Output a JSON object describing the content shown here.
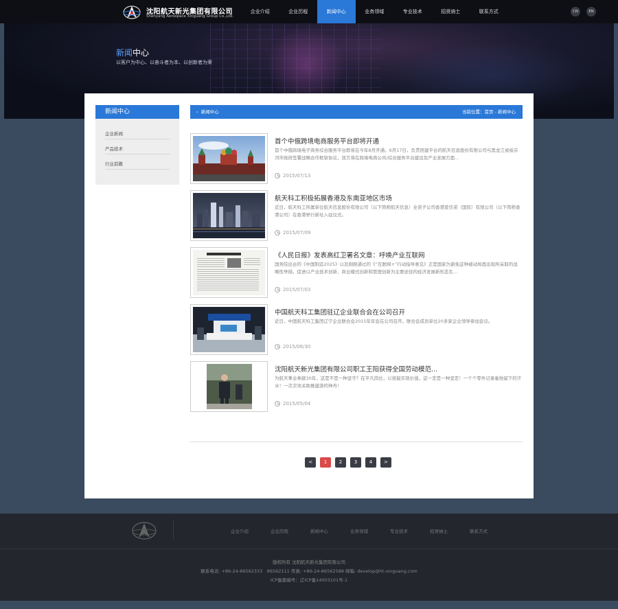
{
  "header": {
    "logo_cn": "沈阳航天新光集团有限公司",
    "logo_en": "Shenyang Aerospace Xinguang Group Co.,Ltd.",
    "nav": [
      "企业介绍",
      "企业历程",
      "新闻中心",
      "业务领域",
      "专业技术",
      "招贤纳士",
      "联系方式"
    ],
    "active_nav": 2,
    "lang": [
      "CN",
      "EN"
    ]
  },
  "hero": {
    "title_hl": "新闻",
    "title_rest": "中心",
    "subtitle": "以客户为中心、以奋斗者为本、以创新者为荣"
  },
  "sidebar": {
    "title": "新闻中心",
    "items": [
      "企业新闻",
      "产品技术",
      "行业前瞻"
    ]
  },
  "breadcrumb": {
    "section": "新闻中心",
    "location_label": "当前位置：",
    "home": "首页",
    "sep": " - ",
    "current": "新闻中心"
  },
  "news": [
    {
      "title": "首个中俄跨境电商服务平台即将开通",
      "desc": "首个中俄跨境电子商务综合服务平台即将在今年8月开通。6月17日，负责搭建平台的航天信息股份有限公司与黑龙江省绥芬河市政府签署战略合作框架协议，双方将在跨境电商公共/综合服务平台建设及产业发展方面...",
      "date": "2015/07/13",
      "image": "moscow-kremlin-photo"
    },
    {
      "title": "航天科工积极拓展香港及东南亚地区市场",
      "desc": "近日，航天科工所属单位航天信息股份有限公司（以下简称航天信息）全资子公司香港爱信诺（国际）有限公司（以下简称香港公司）在香港举行新址入驻仪式。",
      "date": "2015/07/09",
      "image": "hongkong-skyline-photo"
    },
    {
      "title": "《人民日报》发表高红卫署名文章：呼唤产业互联网",
      "desc": "国务院出台的《中国制造2025》以及刚刚通过的《“互联网+”行动指导意见》正是国家为避免这种被动局面出现所采取的战略性举措，促进以产业技术创新、商业模式创新和管理创新为主要途径的经济发展新形态生...",
      "date": "2015/07/03",
      "image": "newspaper-page-photo"
    },
    {
      "title": "中国航天科工集团驻辽企业联合会在公司召开",
      "desc": "近日，中国航天科工集团辽宁企业联合会2015年年会在公司召开。联合会成员单位20多家企业领导参加会议。",
      "date": "2015/06/30",
      "image": "exhibition-booth-photo"
    },
    {
      "title": "沈阳航天新光集团有限公司职工王阳获得全国劳动模范...",
      "desc": "为航天事业奉献30年，这是不是一种坚守？在平凡岗位，以技能实现价值，这一定是一种坚定！一个个零件记录着他留下的汗水！一次次攻关助推遨游的神舟！",
      "date": "2015/05/04",
      "image": "worker-portrait-photo"
    }
  ],
  "pager": [
    "<",
    "1",
    "2",
    "3",
    "4",
    ">"
  ],
  "pager_active": 1,
  "footer": {
    "nav": [
      "企业介绍",
      "企业历程",
      "新闻中心",
      "业务领域",
      "专业技术",
      "招贤纳士",
      "联系方式"
    ],
    "copyright": "版权所有 沈阳航天新光集团有限公司",
    "contact": "联系电话: +86-24-86562333　86562111 传真: +86-24-86562588 邮箱: develop@ht-xinguang.com",
    "icp": "ICP备案编号：辽ICP备14003101号-1"
  },
  "colors": {
    "accent": "#2a78d8",
    "page_active": "#d94a48",
    "background": "#3a4a5f"
  }
}
